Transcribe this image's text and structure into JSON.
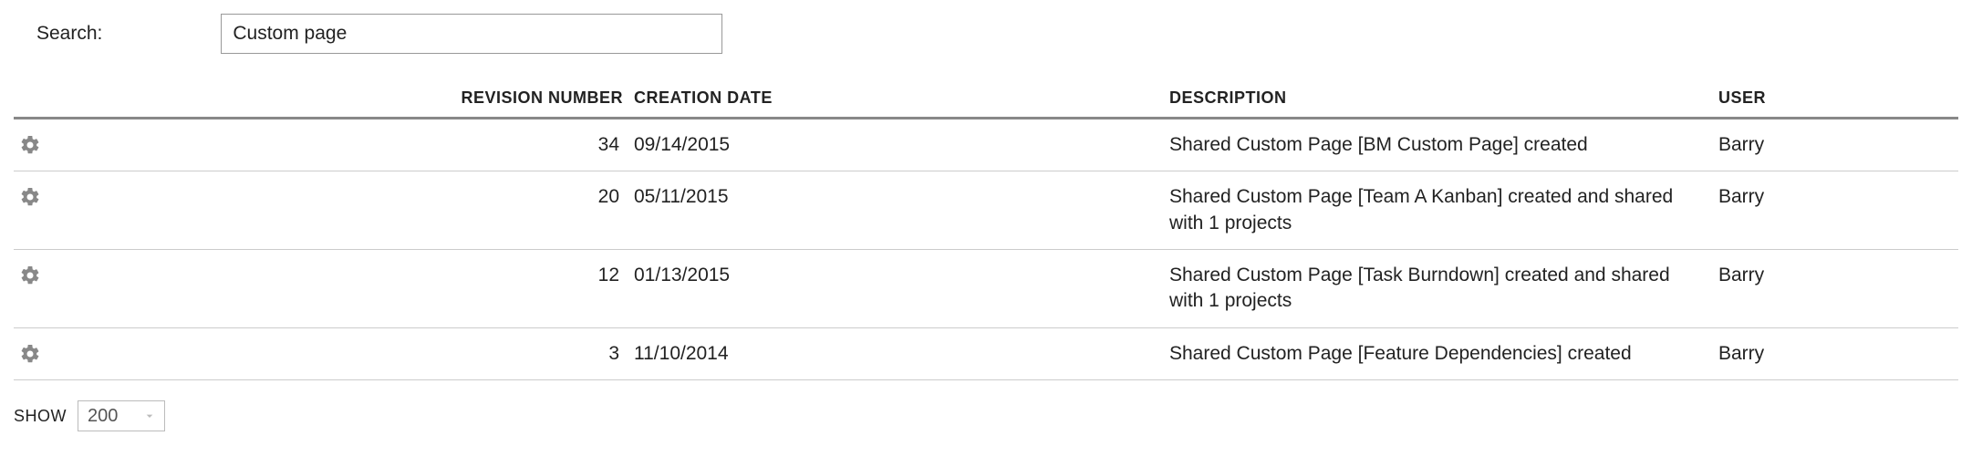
{
  "search": {
    "label": "Search:",
    "value": "Custom page"
  },
  "columns": {
    "revision": "Revision Number",
    "creation_date": "Creation Date",
    "description": "Description",
    "user": "User"
  },
  "rows": [
    {
      "revision": "34",
      "date": "09/14/2015",
      "description": "Shared Custom Page [BM Custom Page] created",
      "user": "Barry"
    },
    {
      "revision": "20",
      "date": "05/11/2015",
      "description": "Shared Custom Page [Team A Kanban] created and shared with 1 projects",
      "user": "Barry"
    },
    {
      "revision": "12",
      "date": "01/13/2015",
      "description": "Shared Custom Page [Task Burndown] created and shared with 1 projects",
      "user": "Barry"
    },
    {
      "revision": "3",
      "date": "11/10/2014",
      "description": "Shared Custom Page [Feature Dependencies] created",
      "user": "Barry"
    }
  ],
  "pager": {
    "show_label": "Show",
    "page_size": "200"
  }
}
